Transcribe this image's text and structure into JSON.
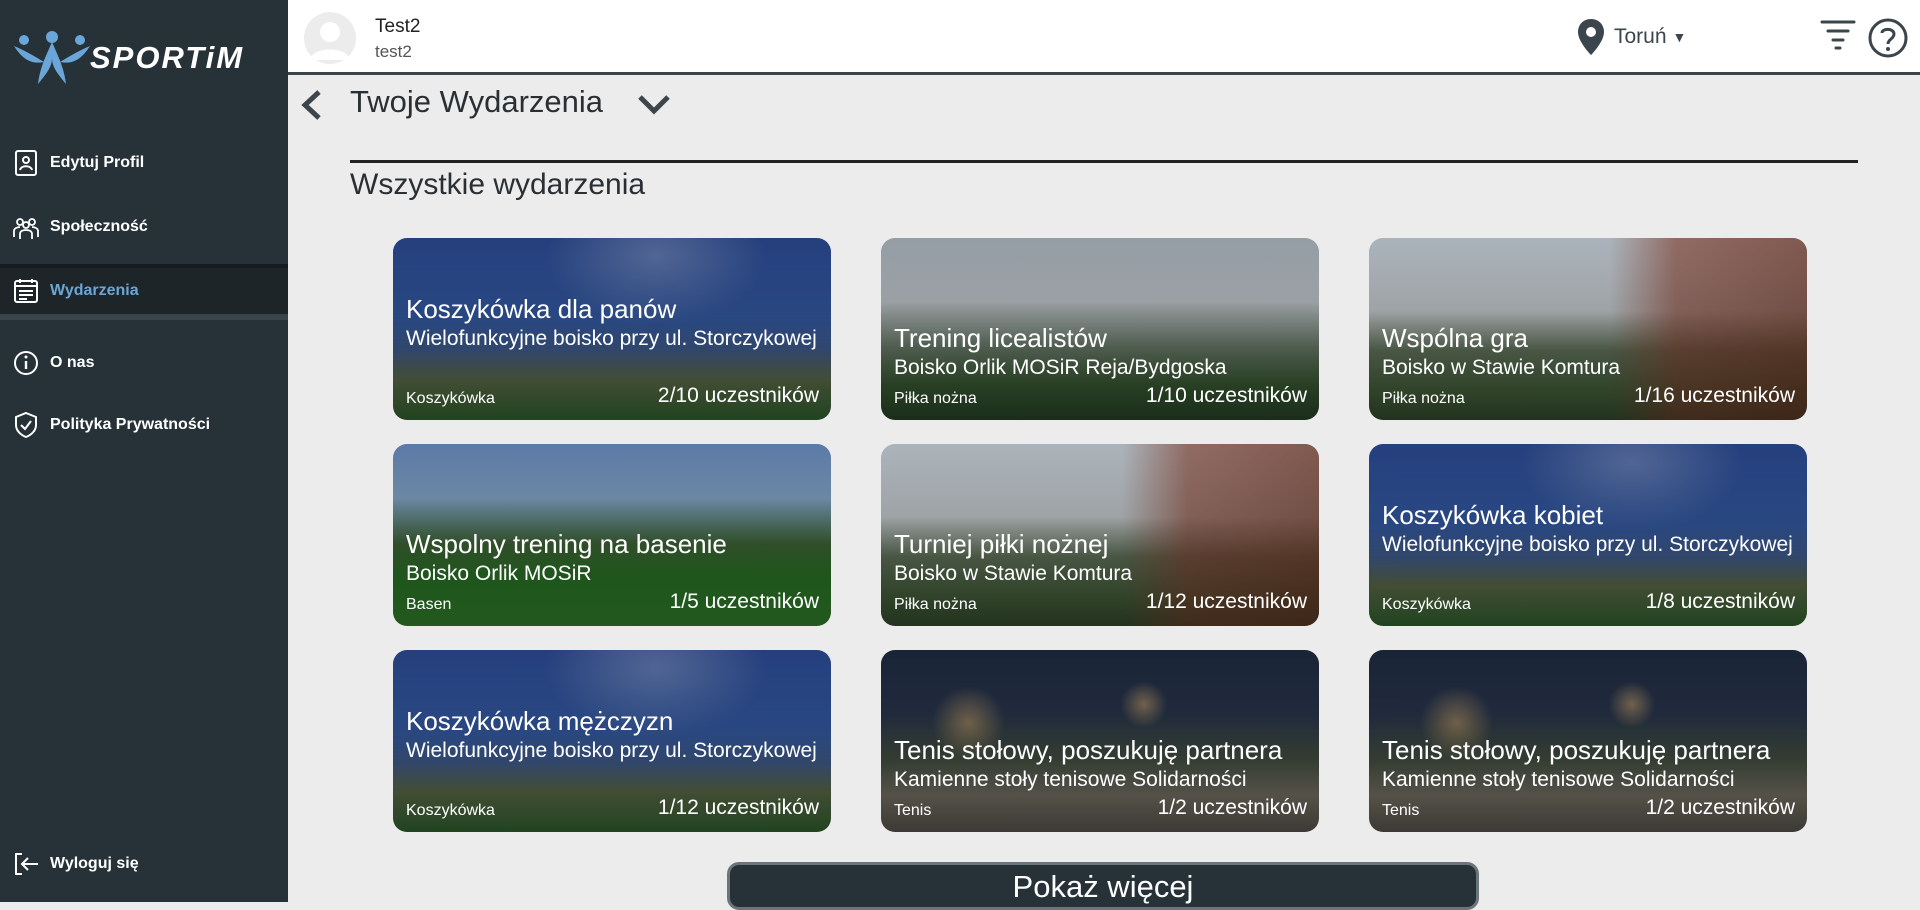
{
  "app": {
    "logo_text": "SPORTiM"
  },
  "sidebar": {
    "items": [
      {
        "label": "Edytuj Profil",
        "icon": "profile-card-icon"
      },
      {
        "label": "Społeczność",
        "icon": "people-icon"
      },
      {
        "label": "Wydarzenia",
        "icon": "calendar-icon",
        "active": true
      },
      {
        "label": "O nas",
        "icon": "info-icon"
      },
      {
        "label": "Polityka Prywatności",
        "icon": "shield-check-icon"
      }
    ],
    "logout": {
      "label": "Wyloguj się",
      "icon": "logout-icon"
    }
  },
  "header": {
    "user_name": "Test2",
    "user_login": "test2",
    "location": "Toruń",
    "location_icon": "map-pin-icon",
    "filter_icon": "filter-icon",
    "help_icon": "help-icon"
  },
  "main": {
    "page_title": "Twoje Wydarzenia",
    "section_title": "Wszystkie wydarzenia",
    "events": [
      {
        "title": "Koszykówka dla panów",
        "location": "Wielofunkcyjne boisko przy ul. Storczykowej",
        "sport": "Koszykówka",
        "participants": "2/10 uczestników",
        "image": "basketball-hoop"
      },
      {
        "title": "Trening licealistów",
        "location": "Boisko Orlik MOSiR Reja/Bydgoska",
        "sport": "Piłka nożna",
        "participants": "1/10 uczestników",
        "image": "football-field"
      },
      {
        "title": "Wspólna gra",
        "location": "Boisko w Stawie Komtura",
        "sport": "Piłka nożna",
        "participants": "1/16 uczestników",
        "image": "castle-field"
      },
      {
        "title": "Wspolny trening na basenie",
        "location": "Boisko Orlik MOSiR",
        "sport": "Basen",
        "participants": "1/5 uczestników",
        "image": "artificial-pitch"
      },
      {
        "title": "Turniej piłki nożnej",
        "location": "Boisko w Stawie Komtura",
        "sport": "Piłka nożna",
        "participants": "1/12 uczestników",
        "image": "castle-field"
      },
      {
        "title": "Koszykówka kobiet",
        "location": "Wielofunkcyjne boisko przy ul. Storczykowej",
        "sport": "Koszykówka",
        "participants": "1/8 uczestników",
        "image": "basketball-hoop"
      },
      {
        "title": "Koszykówka mężczyzn",
        "location": "Wielofunkcyjne boisko przy ul. Storczykowej",
        "sport": "Koszykówka",
        "participants": "1/12 uczestników",
        "image": "basketball-hoop"
      },
      {
        "title": "Tenis stołowy, poszukuję partnera",
        "location": "Kamienne stoły tenisowe Solidarności",
        "sport": "Tenis",
        "participants": "1/2 uczestników",
        "image": "tennis-tables"
      },
      {
        "title": "Tenis stołowy, poszukuję partnera",
        "location": "Kamienne stoły tenisowe Solidarności",
        "sport": "Tenis",
        "participants": "1/2 uczestników",
        "image": "tennis-tables"
      }
    ],
    "show_more_label": "Pokaż więcej"
  },
  "colors": {
    "sidebar_bg": "#263238",
    "active_nav_text": "#6aa6d8",
    "page_bg": "#ececec"
  }
}
